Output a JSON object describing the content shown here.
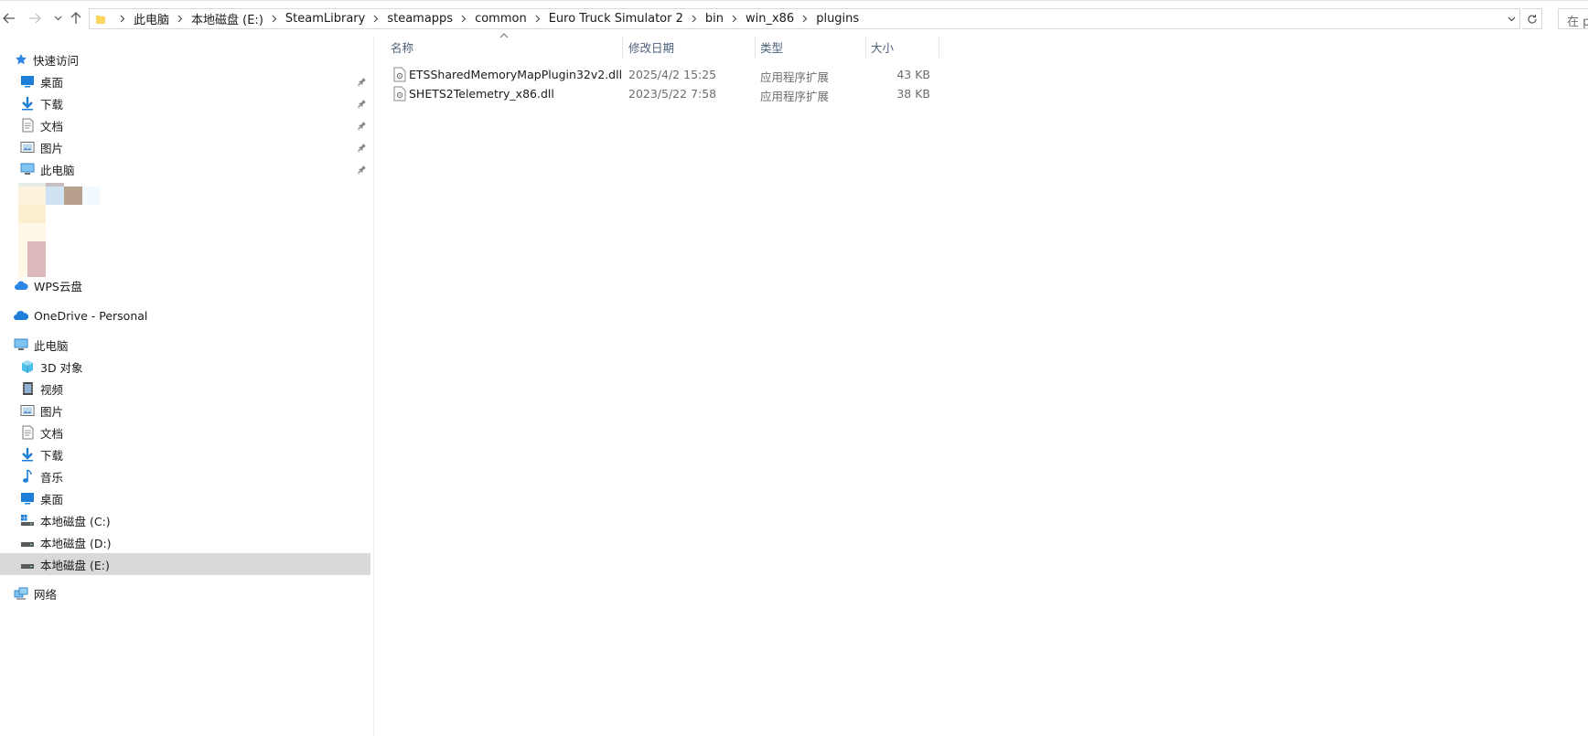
{
  "address_bar": {
    "breadcrumbs": [
      "此电脑",
      "本地磁盘 (E:)",
      "SteamLibrary",
      "steamapps",
      "common",
      "Euro Truck Simulator 2",
      "bin",
      "win_x86",
      "plugins"
    ],
    "search_placeholder": "在 p"
  },
  "sidebar": {
    "quick_access": {
      "label": "快速访问",
      "items": [
        {
          "label": "桌面",
          "icon": "desktop-icon",
          "pinned": true
        },
        {
          "label": "下载",
          "icon": "download-icon",
          "pinned": true
        },
        {
          "label": "文档",
          "icon": "documents-icon",
          "pinned": true
        },
        {
          "label": "图片",
          "icon": "pictures-icon",
          "pinned": true
        },
        {
          "label": "此电脑",
          "icon": "computer-icon",
          "pinned": true
        }
      ]
    },
    "wps": {
      "label": "WPS云盘"
    },
    "onedrive": {
      "label": "OneDrive - Personal"
    },
    "this_pc": {
      "label": "此电脑",
      "items": [
        {
          "label": "3D 对象",
          "icon": "3d-objects-icon"
        },
        {
          "label": "视频",
          "icon": "videos-icon"
        },
        {
          "label": "图片",
          "icon": "pictures-icon"
        },
        {
          "label": "文档",
          "icon": "documents-icon"
        },
        {
          "label": "下载",
          "icon": "download-icon"
        },
        {
          "label": "音乐",
          "icon": "music-icon"
        },
        {
          "label": "桌面",
          "icon": "desktop-icon"
        },
        {
          "label": "本地磁盘 (C:)",
          "icon": "system-drive-icon"
        },
        {
          "label": "本地磁盘 (D:)",
          "icon": "drive-icon"
        },
        {
          "label": "本地磁盘 (E:)",
          "icon": "drive-icon",
          "selected": true
        }
      ]
    },
    "network": {
      "label": "网络"
    }
  },
  "columns": {
    "name": "名称",
    "date": "修改日期",
    "type": "类型",
    "size": "大小"
  },
  "files": [
    {
      "name": "ETSSharedMemoryMapPlugin32v2.dll",
      "date": "2025/4/2 15:25",
      "type": "应用程序扩展",
      "size": "43 KB"
    },
    {
      "name": "SHETS2Telemetry_x86.dll",
      "date": "2023/5/22 7:58",
      "type": "应用程序扩展",
      "size": "38 KB"
    }
  ],
  "colors": {
    "selection": "#d9d9d9",
    "header_text": "#4c607a",
    "folder": "#ffd75e",
    "accent_blue": "#1e90ff"
  }
}
